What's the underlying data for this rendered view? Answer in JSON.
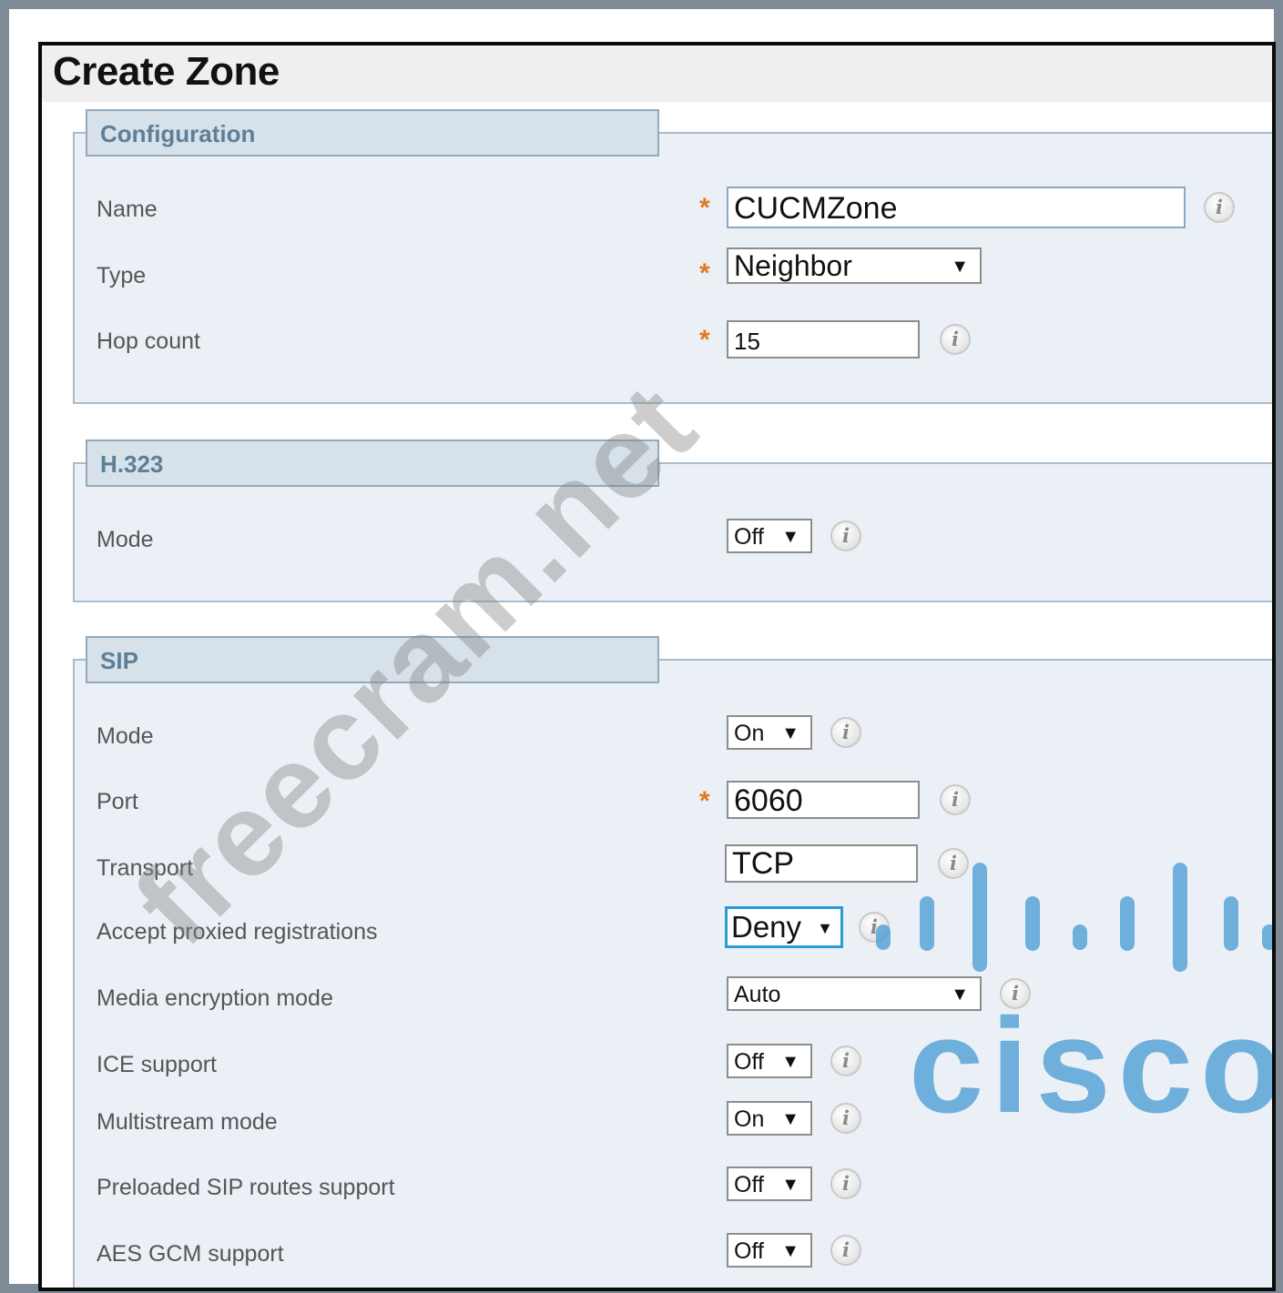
{
  "page": {
    "title": "Create Zone"
  },
  "configuration": {
    "legend": "Configuration",
    "name": {
      "label": "Name",
      "value": "CUCMZone"
    },
    "type": {
      "label": "Type",
      "value": "Neighbor"
    },
    "hop_count": {
      "label": "Hop count",
      "value": "15"
    }
  },
  "h323": {
    "legend": "H.323",
    "mode": {
      "label": "Mode",
      "value": "Off"
    }
  },
  "sip": {
    "legend": "SIP",
    "mode": {
      "label": "Mode",
      "value": "On"
    },
    "port": {
      "label": "Port",
      "value": "6060"
    },
    "transport": {
      "label": "Transport",
      "value": "TCP"
    },
    "accept_proxied": {
      "label": "Accept proxied registrations",
      "value": "Deny"
    },
    "media_encryption": {
      "label": "Media encryption mode",
      "value": "Auto"
    },
    "ice_support": {
      "label": "ICE support",
      "value": "Off"
    },
    "multistream": {
      "label": "Multistream mode",
      "value": "On"
    },
    "preloaded_routes": {
      "label": "Preloaded SIP routes support",
      "value": "Off"
    },
    "aes_gcm": {
      "label": "AES GCM support",
      "value": "Off"
    }
  },
  "symbols": {
    "required": "*",
    "dropdown_arrow": "▼",
    "info": "i"
  },
  "watermark": "freecram.net",
  "logo": {
    "text": "cisco"
  },
  "colors": {
    "required_star": "#e07b1b",
    "legend_text": "#5d7f98",
    "section_bg": "#eaf0f5",
    "logo_blue": "#4096d2"
  }
}
